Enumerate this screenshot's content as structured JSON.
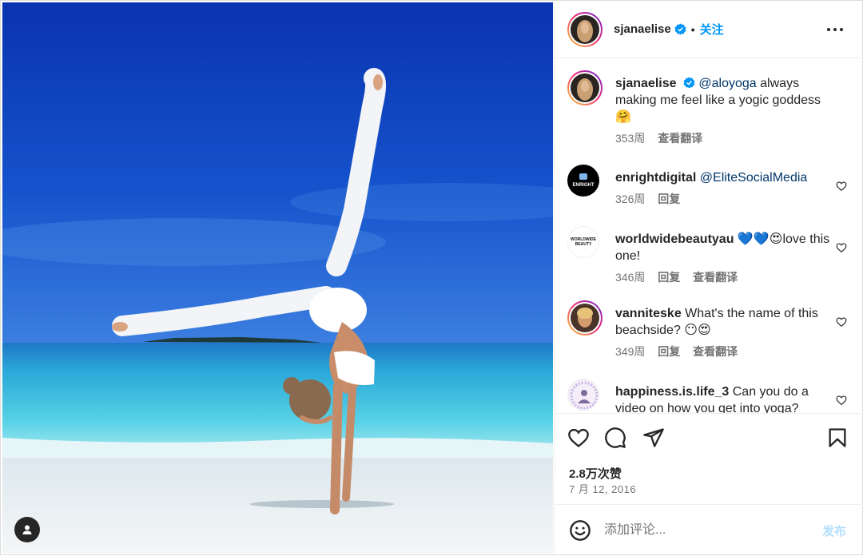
{
  "header": {
    "username": "sjanaelise",
    "separator": "•",
    "follow_label": "关注"
  },
  "caption": {
    "username": "sjanaelise",
    "mention": "@aloyoga",
    "text": "always making me feel like a yogic goddess 🤗",
    "time": "353周",
    "translate": "查看翻译"
  },
  "comments": [
    {
      "username": "enrightdigital",
      "mention": "@EliteSocialMedia",
      "text": "",
      "time": "326周",
      "reply": "回复",
      "translate": "",
      "avatar_label": "ENRIGHT"
    },
    {
      "username": "worldwidebeautyau",
      "mention": "",
      "text": "💙💙😍love this one!",
      "time": "346周",
      "reply": "回复",
      "translate": "查看翻译",
      "avatar_label_1": "WORLDWIDE",
      "avatar_label_2": "BEAUTY"
    },
    {
      "username": "vanniteske",
      "mention": "",
      "text": "What's the name of this beachside? 😶😍",
      "time": "349周",
      "reply": "回复",
      "translate": "查看翻译"
    },
    {
      "username": "happiness.is.life_3",
      "mention": "",
      "text": "Can you do a video on how you get into yoga?",
      "time": "",
      "reply": "",
      "translate": ""
    }
  ],
  "stats": {
    "likes": "2.8万次赞",
    "date": "7 月 12, 2016"
  },
  "add_comment": {
    "placeholder": "添加评论...",
    "post_label": "发布"
  },
  "colors": {
    "accent": "#0095f6",
    "post_disabled": "#b2dffc",
    "mention": "#00376b",
    "sky_top": "#0a36b4",
    "sea": "#36c1df",
    "sand": "#eef2f4"
  },
  "icons": {
    "more": "more-icon",
    "verified": "verified-badge-icon",
    "like": "heart-icon",
    "comment": "comment-icon",
    "share": "send-icon",
    "save": "bookmark-icon",
    "emoji": "emoji-icon",
    "tag": "user-tag-icon"
  }
}
